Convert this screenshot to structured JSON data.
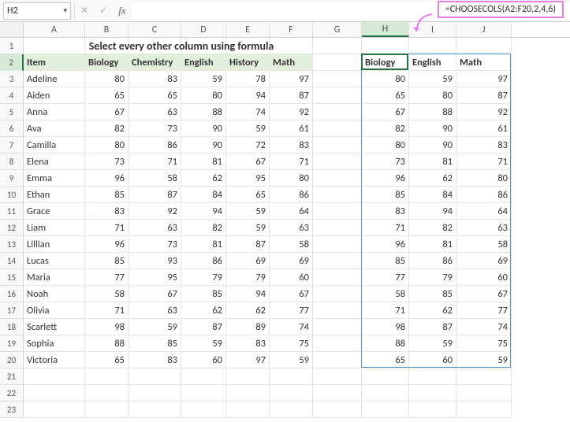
{
  "namebox": {
    "value": "H2"
  },
  "formula_bar": {
    "value": ""
  },
  "callout": {
    "formula": "=CHOOSECOLS(A2:F20,2,4,6)"
  },
  "columns": [
    "A",
    "B",
    "C",
    "D",
    "E",
    "F",
    "G",
    "H",
    "I",
    "J"
  ],
  "row_numbers": [
    "1",
    "2",
    "3",
    "4",
    "5",
    "6",
    "7",
    "8",
    "9",
    "10",
    "11",
    "12",
    "13",
    "14",
    "15",
    "16",
    "17",
    "18",
    "19",
    "20",
    "21",
    "22",
    "23"
  ],
  "title": "Select every other column using formula",
  "headers": {
    "A": "Item",
    "B": "Biology",
    "C": "Chemistry",
    "D": "English",
    "E": "History",
    "F": "Math"
  },
  "spill_headers": {
    "H": "Biology",
    "I": "English",
    "J": "Math"
  },
  "active_col": "H",
  "active_row": "2",
  "chart_data": {
    "type": "table",
    "title": "Select every other column using formula",
    "columns": [
      "Item",
      "Biology",
      "Chemistry",
      "English",
      "History",
      "Math"
    ],
    "rows": [
      {
        "Item": "Adeline",
        "Biology": 80,
        "Chemistry": 83,
        "English": 59,
        "History": 78,
        "Math": 97
      },
      {
        "Item": "Aiden",
        "Biology": 65,
        "Chemistry": 65,
        "English": 80,
        "History": 94,
        "Math": 87
      },
      {
        "Item": "Anna",
        "Biology": 67,
        "Chemistry": 63,
        "English": 88,
        "History": 74,
        "Math": 92
      },
      {
        "Item": "Ava",
        "Biology": 82,
        "Chemistry": 73,
        "English": 90,
        "History": 59,
        "Math": 61
      },
      {
        "Item": "Camilla",
        "Biology": 80,
        "Chemistry": 86,
        "English": 90,
        "History": 72,
        "Math": 83
      },
      {
        "Item": "Elena",
        "Biology": 73,
        "Chemistry": 71,
        "English": 81,
        "History": 67,
        "Math": 71
      },
      {
        "Item": "Emma",
        "Biology": 96,
        "Chemistry": 58,
        "English": 62,
        "History": 95,
        "Math": 80
      },
      {
        "Item": "Ethan",
        "Biology": 85,
        "Chemistry": 87,
        "English": 84,
        "History": 65,
        "Math": 86
      },
      {
        "Item": "Grace",
        "Biology": 83,
        "Chemistry": 92,
        "English": 94,
        "History": 59,
        "Math": 64
      },
      {
        "Item": "Liam",
        "Biology": 71,
        "Chemistry": 63,
        "English": 82,
        "History": 59,
        "Math": 63
      },
      {
        "Item": "Lillian",
        "Biology": 96,
        "Chemistry": 73,
        "English": 81,
        "History": 87,
        "Math": 58
      },
      {
        "Item": "Lucas",
        "Biology": 85,
        "Chemistry": 93,
        "English": 86,
        "History": 69,
        "Math": 69
      },
      {
        "Item": "Maria",
        "Biology": 77,
        "Chemistry": 95,
        "English": 79,
        "History": 79,
        "Math": 60
      },
      {
        "Item": "Noah",
        "Biology": 58,
        "Chemistry": 67,
        "English": 85,
        "History": 94,
        "Math": 67
      },
      {
        "Item": "Olivia",
        "Biology": 71,
        "Chemistry": 63,
        "English": 62,
        "History": 62,
        "Math": 77
      },
      {
        "Item": "Scarlett",
        "Biology": 98,
        "Chemistry": 59,
        "English": 87,
        "History": 89,
        "Math": 74
      },
      {
        "Item": "Sophia",
        "Biology": 88,
        "Chemistry": 85,
        "English": 59,
        "History": 83,
        "Math": 75
      },
      {
        "Item": "Victoria",
        "Biology": 65,
        "Chemistry": 83,
        "English": 60,
        "History": 97,
        "Math": 59
      }
    ],
    "spill_columns": [
      "Biology",
      "English",
      "Math"
    ]
  }
}
